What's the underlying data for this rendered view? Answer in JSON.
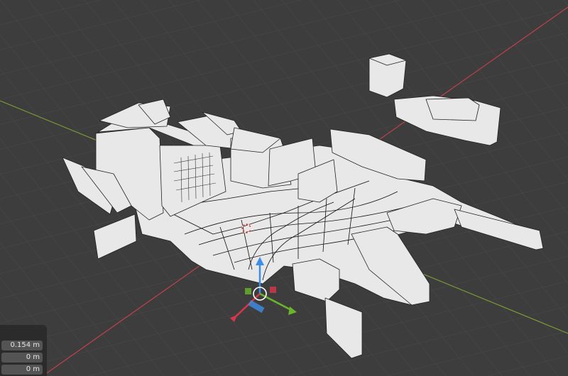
{
  "viewport": {
    "background": "#3d3d3d",
    "x_axis_color": "#c0404f",
    "y_axis_color": "#7a9a35",
    "model_fill": "#e8e8e8",
    "wire_color": "#222222"
  },
  "gizmo": {
    "icons": [
      "move-gizmo-z-arrow-icon",
      "move-gizmo-x-arrow-icon",
      "move-gizmo-y-arrow-icon",
      "move-gizmo-center-ring-icon"
    ],
    "colors": {
      "x": "#d9364b",
      "y": "#6ab52a",
      "z": "#3d8ee8"
    }
  },
  "props_panel": {
    "fields": [
      {
        "value": "0.154 m"
      },
      {
        "value": "0 m"
      },
      {
        "value": "0 m"
      }
    ]
  }
}
